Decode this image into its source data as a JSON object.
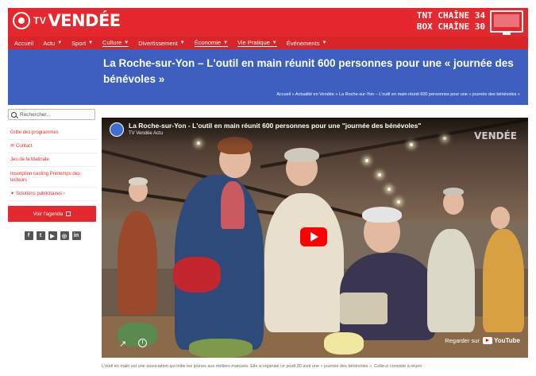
{
  "header": {
    "logo_tv": "TV",
    "logo_brand": "VENDÉE",
    "channel_tnt": "TNT CHAÎNE 34",
    "channel_box": "BOX CHAÎNE 30",
    "brand_color": "#e5282d"
  },
  "nav": {
    "items": [
      {
        "label": "Accueil",
        "has_dropdown": false
      },
      {
        "label": "Actu",
        "has_dropdown": true
      },
      {
        "label": "Sport",
        "has_dropdown": true
      },
      {
        "label": "Culture",
        "has_dropdown": true
      },
      {
        "label": "Divertissement",
        "has_dropdown": true
      },
      {
        "label": "Économie",
        "has_dropdown": true
      },
      {
        "label": "Vie Pratique",
        "has_dropdown": true
      },
      {
        "label": "Événements",
        "has_dropdown": true
      }
    ]
  },
  "page": {
    "title": "La Roche-sur-Yon – L'outil en main réunit 600 personnes pour une « journée des bénévoles »",
    "breadcrumb": "Accueil » Actualité en Vendée » La Roche-sur-Yon – L'outil en main réunit 600 personnes pour une « journée des bénévoles »",
    "band_color": "#3e5fbf"
  },
  "sidebar": {
    "search_placeholder": "Rechercher...",
    "links": [
      "Grille des programmes",
      "Contact",
      "Jeu de la Matinale",
      "Inscription casting Printemps des lecteurs",
      "Solutions publicitaires"
    ],
    "agenda_button": "Voir l'agenda"
  },
  "video": {
    "title": "La Roche-sur-Yon - L'outil en main réunit 600 personnes pour une \"journée des bénévoles\"",
    "channel": "TV Vendée Actu",
    "watermark": "VENDÉE",
    "watch_on": "Regarder sur",
    "youtube": "YouTube"
  },
  "article": {
    "intro": "L'outil en main est une association qui initie les jeunes aux métiers manuels. Elle a organisé ce jeudi 30 avril une « journée des bénévoles ». Celle-ci consiste à réunir"
  }
}
